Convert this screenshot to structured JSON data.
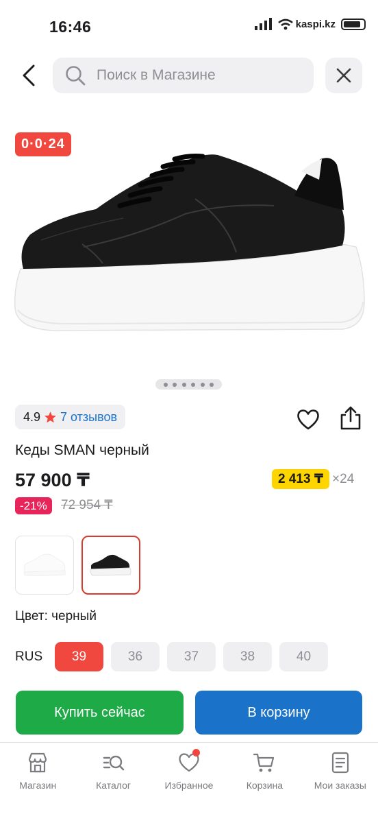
{
  "status": {
    "time": "16:46",
    "watermark": "kaspi.kz"
  },
  "search": {
    "placeholder": "Поиск в Магазине"
  },
  "product": {
    "promo_badge": "0·0·24",
    "rating": "4.9",
    "reviews": "7 отзывов",
    "title": "Кеды SMAN черный",
    "price": "57 900 ₸",
    "installment_amount": "2 413 ₸",
    "installment_months": "×24",
    "discount": "-21%",
    "old_price": "72 954 ₸",
    "color_label": "Цвет: черный",
    "image_count": 6,
    "image_index": 1
  },
  "sizes": {
    "system": "RUS",
    "options": [
      "39",
      "36",
      "37",
      "38",
      "40"
    ],
    "selected": "39"
  },
  "actions": {
    "buy_now": "Купить сейчас",
    "add_to_cart": "В корзину"
  },
  "tabs": [
    {
      "label": "Магазин",
      "icon": "store-icon"
    },
    {
      "label": "Каталог",
      "icon": "catalog-icon"
    },
    {
      "label": "Избранное",
      "icon": "heart-icon"
    },
    {
      "label": "Корзина",
      "icon": "cart-icon"
    },
    {
      "label": "Мои заказы",
      "icon": "orders-icon"
    }
  ],
  "colors": {
    "accent_red": "#f0483e",
    "buy_green": "#1daa47",
    "cart_blue": "#1a73c8",
    "installment_yellow": "#ffd500",
    "discount_pink": "#e8255a"
  }
}
